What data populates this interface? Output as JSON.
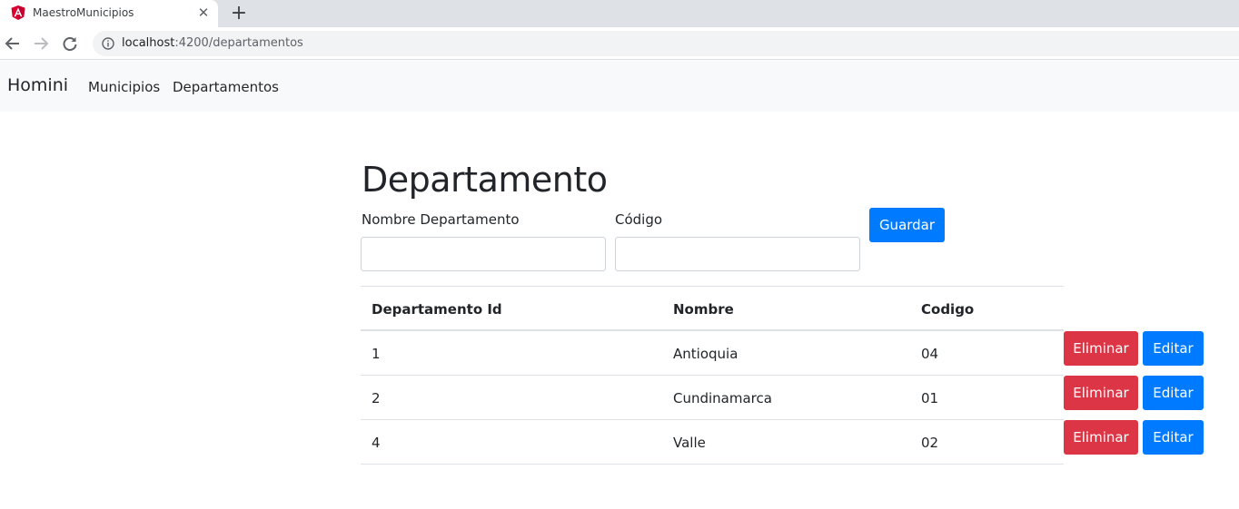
{
  "browser": {
    "tab_title": "MaestroMunicipios",
    "url_host": "localhost",
    "url_path": ":4200/departamentos"
  },
  "navbar": {
    "brand": "Homini",
    "links": [
      {
        "label": "Municipios"
      },
      {
        "label": "Departamentos"
      }
    ]
  },
  "form": {
    "title": "Departamento",
    "name_label": "Nombre Departamento",
    "name_value": "",
    "code_label": "Código",
    "code_value": "",
    "save_label": "Guardar"
  },
  "table": {
    "headers": [
      "Departamento Id",
      "Nombre",
      "Codigo"
    ],
    "rows": [
      {
        "id": "1",
        "nombre": "Antioquia",
        "codigo": "04"
      },
      {
        "id": "2",
        "nombre": "Cundinamarca",
        "codigo": "01"
      },
      {
        "id": "4",
        "nombre": "Valle",
        "codigo": "02"
      }
    ],
    "delete_label": "Eliminar",
    "edit_label": "Editar"
  },
  "colors": {
    "primary": "#007bff",
    "danger": "#dc3545",
    "navbar_bg": "#f8f9fa",
    "angular_red": "#dd0031"
  }
}
